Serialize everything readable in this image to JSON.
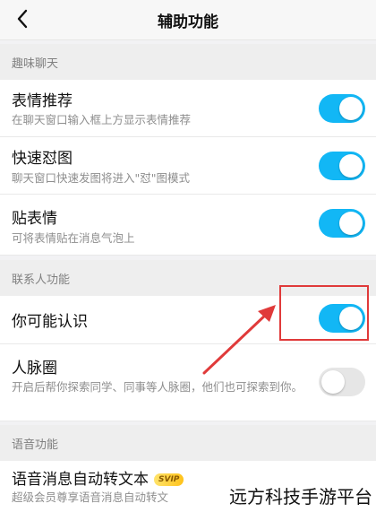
{
  "header": {
    "title": "辅助功能"
  },
  "sections": {
    "fun_chat": "趣味聊天",
    "contacts": "联系人功能",
    "voice": "语音功能"
  },
  "items": {
    "emoji_recommend": {
      "title": "表情推荐",
      "desc": "在聊天窗口输入框上方显示表情推荐",
      "on": true
    },
    "quick_fight": {
      "title": "快速怼图",
      "desc": "聊天窗口快速发图将进入\"怼\"图模式",
      "on": true
    },
    "sticker": {
      "title": "贴表情",
      "desc": "可将表情贴在消息气泡上",
      "on": true
    },
    "may_know": {
      "title": "你可能认识",
      "on": true
    },
    "network": {
      "title": "人脉圈",
      "desc": "开启后帮你探索同学、同事等人脉圈，他们也可探索到你。",
      "on": false
    },
    "voice_to_text": {
      "title": "语音消息自动转文本",
      "badge": "SVIP",
      "desc": "超级会员尊享语音消息自动转文"
    }
  },
  "watermark": "远方科技手游平台",
  "colors": {
    "toggle_on": "#12b7f5",
    "toggle_off": "#e6e6e6",
    "annotation": "#e03a3a"
  }
}
